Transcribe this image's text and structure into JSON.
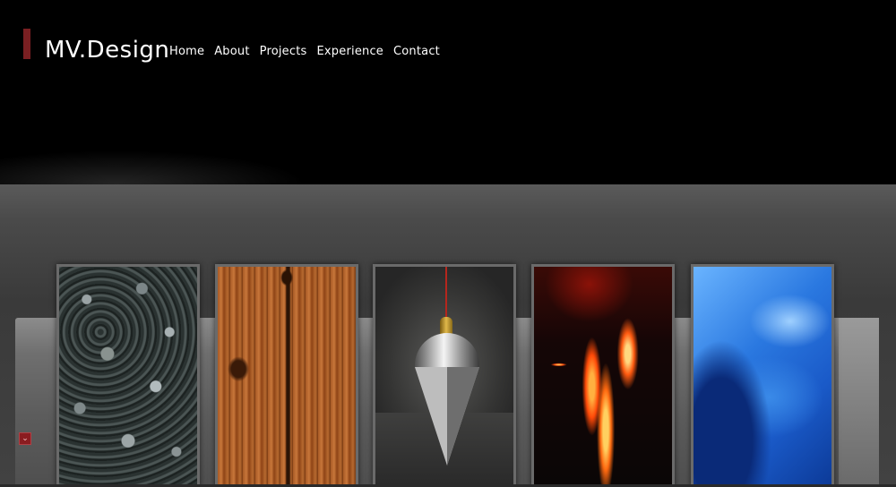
{
  "brand": {
    "name": "MV.Design"
  },
  "nav": {
    "items": [
      {
        "label": "Home"
      },
      {
        "label": "About"
      },
      {
        "label": "Projects"
      },
      {
        "label": "Experience"
      },
      {
        "label": "Contact"
      }
    ]
  },
  "colors": {
    "accent": "#7a1f22",
    "header_bg": "#000000",
    "stage_bg": "#4a4a4a"
  },
  "gallery": {
    "panels": [
      {
        "name": "stones-panel"
      },
      {
        "name": "wood-panel"
      },
      {
        "name": "pendulum-panel"
      },
      {
        "name": "lava-panel"
      },
      {
        "name": "water-panel"
      }
    ]
  },
  "controls": {
    "scroll_down_icon": "chevron-down-icon",
    "scroll_down_glyph": "⌄"
  }
}
